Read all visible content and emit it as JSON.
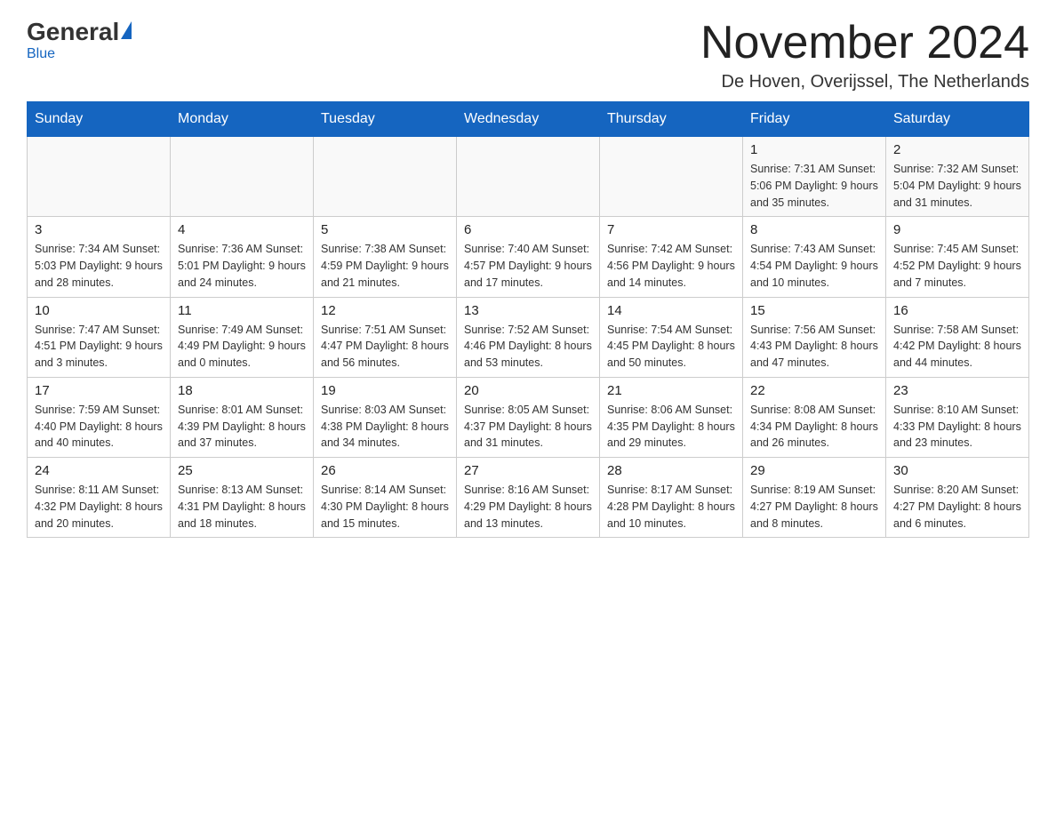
{
  "header": {
    "logo_general": "General",
    "logo_blue": "Blue",
    "month_title": "November 2024",
    "location": "De Hoven, Overijssel, The Netherlands"
  },
  "days_of_week": [
    "Sunday",
    "Monday",
    "Tuesday",
    "Wednesday",
    "Thursday",
    "Friday",
    "Saturday"
  ],
  "weeks": [
    [
      {
        "day": "",
        "info": ""
      },
      {
        "day": "",
        "info": ""
      },
      {
        "day": "",
        "info": ""
      },
      {
        "day": "",
        "info": ""
      },
      {
        "day": "",
        "info": ""
      },
      {
        "day": "1",
        "info": "Sunrise: 7:31 AM\nSunset: 5:06 PM\nDaylight: 9 hours and 35 minutes."
      },
      {
        "day": "2",
        "info": "Sunrise: 7:32 AM\nSunset: 5:04 PM\nDaylight: 9 hours and 31 minutes."
      }
    ],
    [
      {
        "day": "3",
        "info": "Sunrise: 7:34 AM\nSunset: 5:03 PM\nDaylight: 9 hours and 28 minutes."
      },
      {
        "day": "4",
        "info": "Sunrise: 7:36 AM\nSunset: 5:01 PM\nDaylight: 9 hours and 24 minutes."
      },
      {
        "day": "5",
        "info": "Sunrise: 7:38 AM\nSunset: 4:59 PM\nDaylight: 9 hours and 21 minutes."
      },
      {
        "day": "6",
        "info": "Sunrise: 7:40 AM\nSunset: 4:57 PM\nDaylight: 9 hours and 17 minutes."
      },
      {
        "day": "7",
        "info": "Sunrise: 7:42 AM\nSunset: 4:56 PM\nDaylight: 9 hours and 14 minutes."
      },
      {
        "day": "8",
        "info": "Sunrise: 7:43 AM\nSunset: 4:54 PM\nDaylight: 9 hours and 10 minutes."
      },
      {
        "day": "9",
        "info": "Sunrise: 7:45 AM\nSunset: 4:52 PM\nDaylight: 9 hours and 7 minutes."
      }
    ],
    [
      {
        "day": "10",
        "info": "Sunrise: 7:47 AM\nSunset: 4:51 PM\nDaylight: 9 hours and 3 minutes."
      },
      {
        "day": "11",
        "info": "Sunrise: 7:49 AM\nSunset: 4:49 PM\nDaylight: 9 hours and 0 minutes."
      },
      {
        "day": "12",
        "info": "Sunrise: 7:51 AM\nSunset: 4:47 PM\nDaylight: 8 hours and 56 minutes."
      },
      {
        "day": "13",
        "info": "Sunrise: 7:52 AM\nSunset: 4:46 PM\nDaylight: 8 hours and 53 minutes."
      },
      {
        "day": "14",
        "info": "Sunrise: 7:54 AM\nSunset: 4:45 PM\nDaylight: 8 hours and 50 minutes."
      },
      {
        "day": "15",
        "info": "Sunrise: 7:56 AM\nSunset: 4:43 PM\nDaylight: 8 hours and 47 minutes."
      },
      {
        "day": "16",
        "info": "Sunrise: 7:58 AM\nSunset: 4:42 PM\nDaylight: 8 hours and 44 minutes."
      }
    ],
    [
      {
        "day": "17",
        "info": "Sunrise: 7:59 AM\nSunset: 4:40 PM\nDaylight: 8 hours and 40 minutes."
      },
      {
        "day": "18",
        "info": "Sunrise: 8:01 AM\nSunset: 4:39 PM\nDaylight: 8 hours and 37 minutes."
      },
      {
        "day": "19",
        "info": "Sunrise: 8:03 AM\nSunset: 4:38 PM\nDaylight: 8 hours and 34 minutes."
      },
      {
        "day": "20",
        "info": "Sunrise: 8:05 AM\nSunset: 4:37 PM\nDaylight: 8 hours and 31 minutes."
      },
      {
        "day": "21",
        "info": "Sunrise: 8:06 AM\nSunset: 4:35 PM\nDaylight: 8 hours and 29 minutes."
      },
      {
        "day": "22",
        "info": "Sunrise: 8:08 AM\nSunset: 4:34 PM\nDaylight: 8 hours and 26 minutes."
      },
      {
        "day": "23",
        "info": "Sunrise: 8:10 AM\nSunset: 4:33 PM\nDaylight: 8 hours and 23 minutes."
      }
    ],
    [
      {
        "day": "24",
        "info": "Sunrise: 8:11 AM\nSunset: 4:32 PM\nDaylight: 8 hours and 20 minutes."
      },
      {
        "day": "25",
        "info": "Sunrise: 8:13 AM\nSunset: 4:31 PM\nDaylight: 8 hours and 18 minutes."
      },
      {
        "day": "26",
        "info": "Sunrise: 8:14 AM\nSunset: 4:30 PM\nDaylight: 8 hours and 15 minutes."
      },
      {
        "day": "27",
        "info": "Sunrise: 8:16 AM\nSunset: 4:29 PM\nDaylight: 8 hours and 13 minutes."
      },
      {
        "day": "28",
        "info": "Sunrise: 8:17 AM\nSunset: 4:28 PM\nDaylight: 8 hours and 10 minutes."
      },
      {
        "day": "29",
        "info": "Sunrise: 8:19 AM\nSunset: 4:27 PM\nDaylight: 8 hours and 8 minutes."
      },
      {
        "day": "30",
        "info": "Sunrise: 8:20 AM\nSunset: 4:27 PM\nDaylight: 8 hours and 6 minutes."
      }
    ]
  ]
}
